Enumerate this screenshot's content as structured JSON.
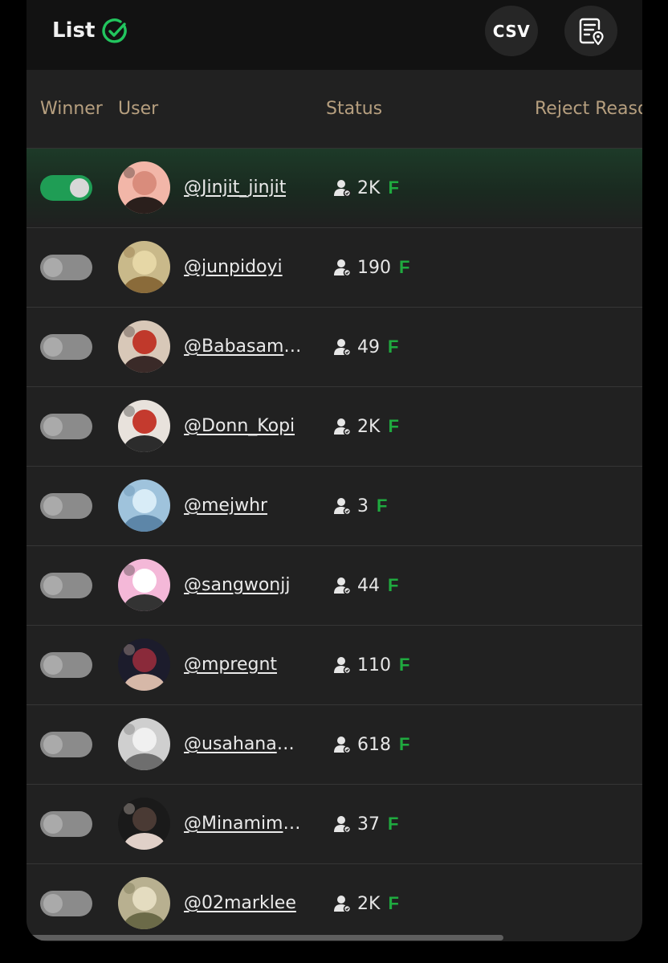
{
  "header": {
    "title": "List",
    "csv_label": "CSV"
  },
  "columns": [
    "Winner",
    "User",
    "Status",
    "Reject Reaso"
  ],
  "rows": [
    {
      "winner": true,
      "username": "@Jinjit_jinjit",
      "count": "2K",
      "badge": "F"
    },
    {
      "winner": false,
      "username": "@junpidoyi",
      "count": "190",
      "badge": "F"
    },
    {
      "winner": false,
      "username": "@Babasamsul",
      "count": "49",
      "badge": "F"
    },
    {
      "winner": false,
      "username": "@Donn_Kopi",
      "count": "2K",
      "badge": "F"
    },
    {
      "winner": false,
      "username": "@mejwhr",
      "count": "3",
      "badge": "F"
    },
    {
      "winner": false,
      "username": "@sangwonjj",
      "count": "44",
      "badge": "F"
    },
    {
      "winner": false,
      "username": "@mpregnt",
      "count": "110",
      "badge": "F"
    },
    {
      "winner": false,
      "username": "@usahananaa",
      "count": "618",
      "badge": "F"
    },
    {
      "winner": false,
      "username": "@Minamimah",
      "count": "37",
      "badge": "F"
    },
    {
      "winner": false,
      "username": "@02marklee",
      "count": "2K",
      "badge": "F"
    }
  ],
  "colors": {
    "accent_green": "#1f9d55",
    "badge_green": "#1faa3f",
    "header_text": "#b69f7f"
  },
  "icons": {
    "title_icon": "check-circle-icon",
    "report_icon": "document-location-icon",
    "status_icon": "person-icon"
  }
}
